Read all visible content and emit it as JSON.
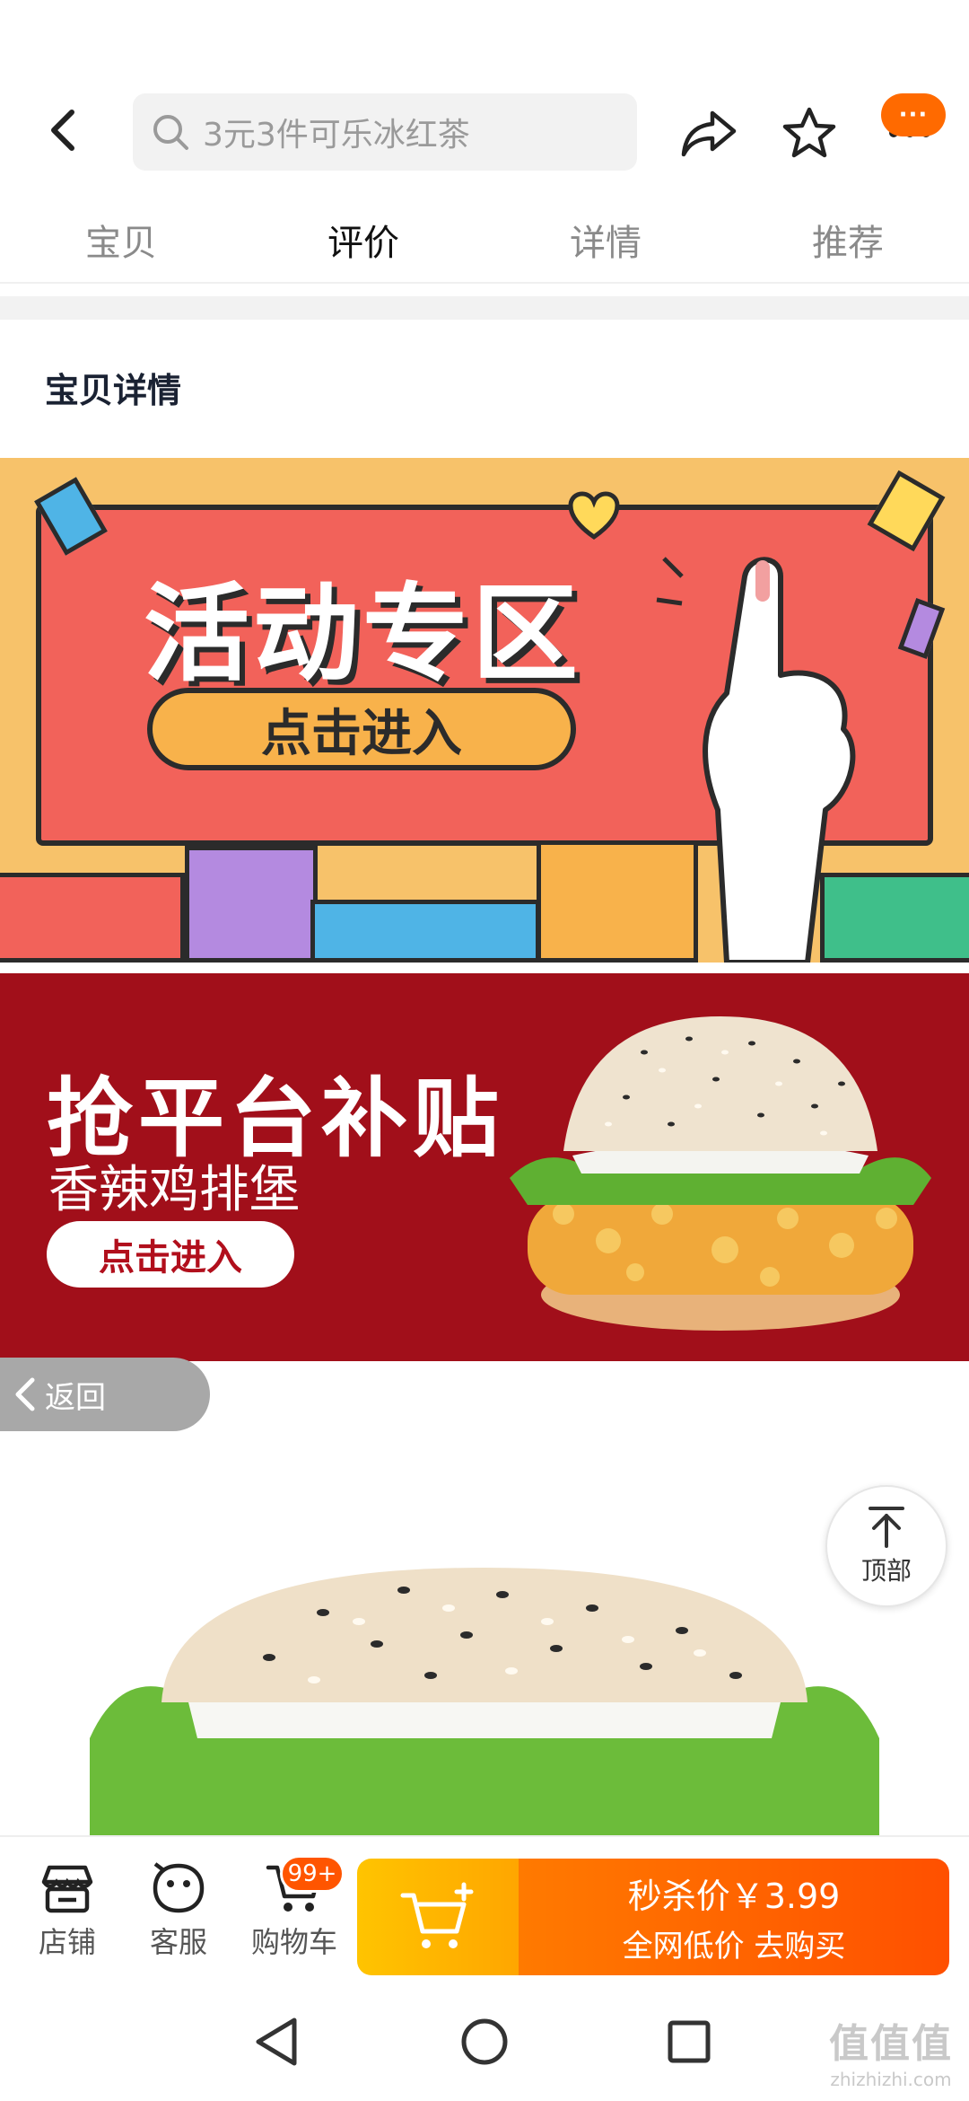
{
  "header": {
    "search_placeholder": "3元3件可乐冰红茶",
    "more_badge": "···",
    "icons": {
      "back": "back-arrow-icon",
      "search": "search-icon",
      "share": "share-icon",
      "favorite": "star-icon",
      "more": "more-icon"
    }
  },
  "tabs": [
    {
      "label": "宝贝",
      "active": false
    },
    {
      "label": "评价",
      "active": true
    },
    {
      "label": "详情",
      "active": false
    },
    {
      "label": "推荐",
      "active": false
    }
  ],
  "section": {
    "title": "宝贝详情"
  },
  "banner1": {
    "title": "活动专区",
    "button": "点击进入"
  },
  "banner2": {
    "title": "抢平台补贴",
    "subtitle": "香辣鸡排堡",
    "button": "点击进入"
  },
  "floating": {
    "return_label": "返回",
    "top_label": "顶部"
  },
  "bottom_bar": {
    "shop_label": "店铺",
    "service_label": "客服",
    "cart_label": "购物车",
    "cart_badge": "99+",
    "buy_price": "秒杀价￥3.99",
    "buy_sub": "全网低价  去购买"
  },
  "watermark": {
    "big": "值值值",
    "small": "zhizhizhi.com"
  },
  "colors": {
    "accent_orange": "#ff6a00",
    "banner2_red": "#a10f1a",
    "banner1_red": "#f2625a",
    "banner1_yellow": "#f7c26a"
  }
}
